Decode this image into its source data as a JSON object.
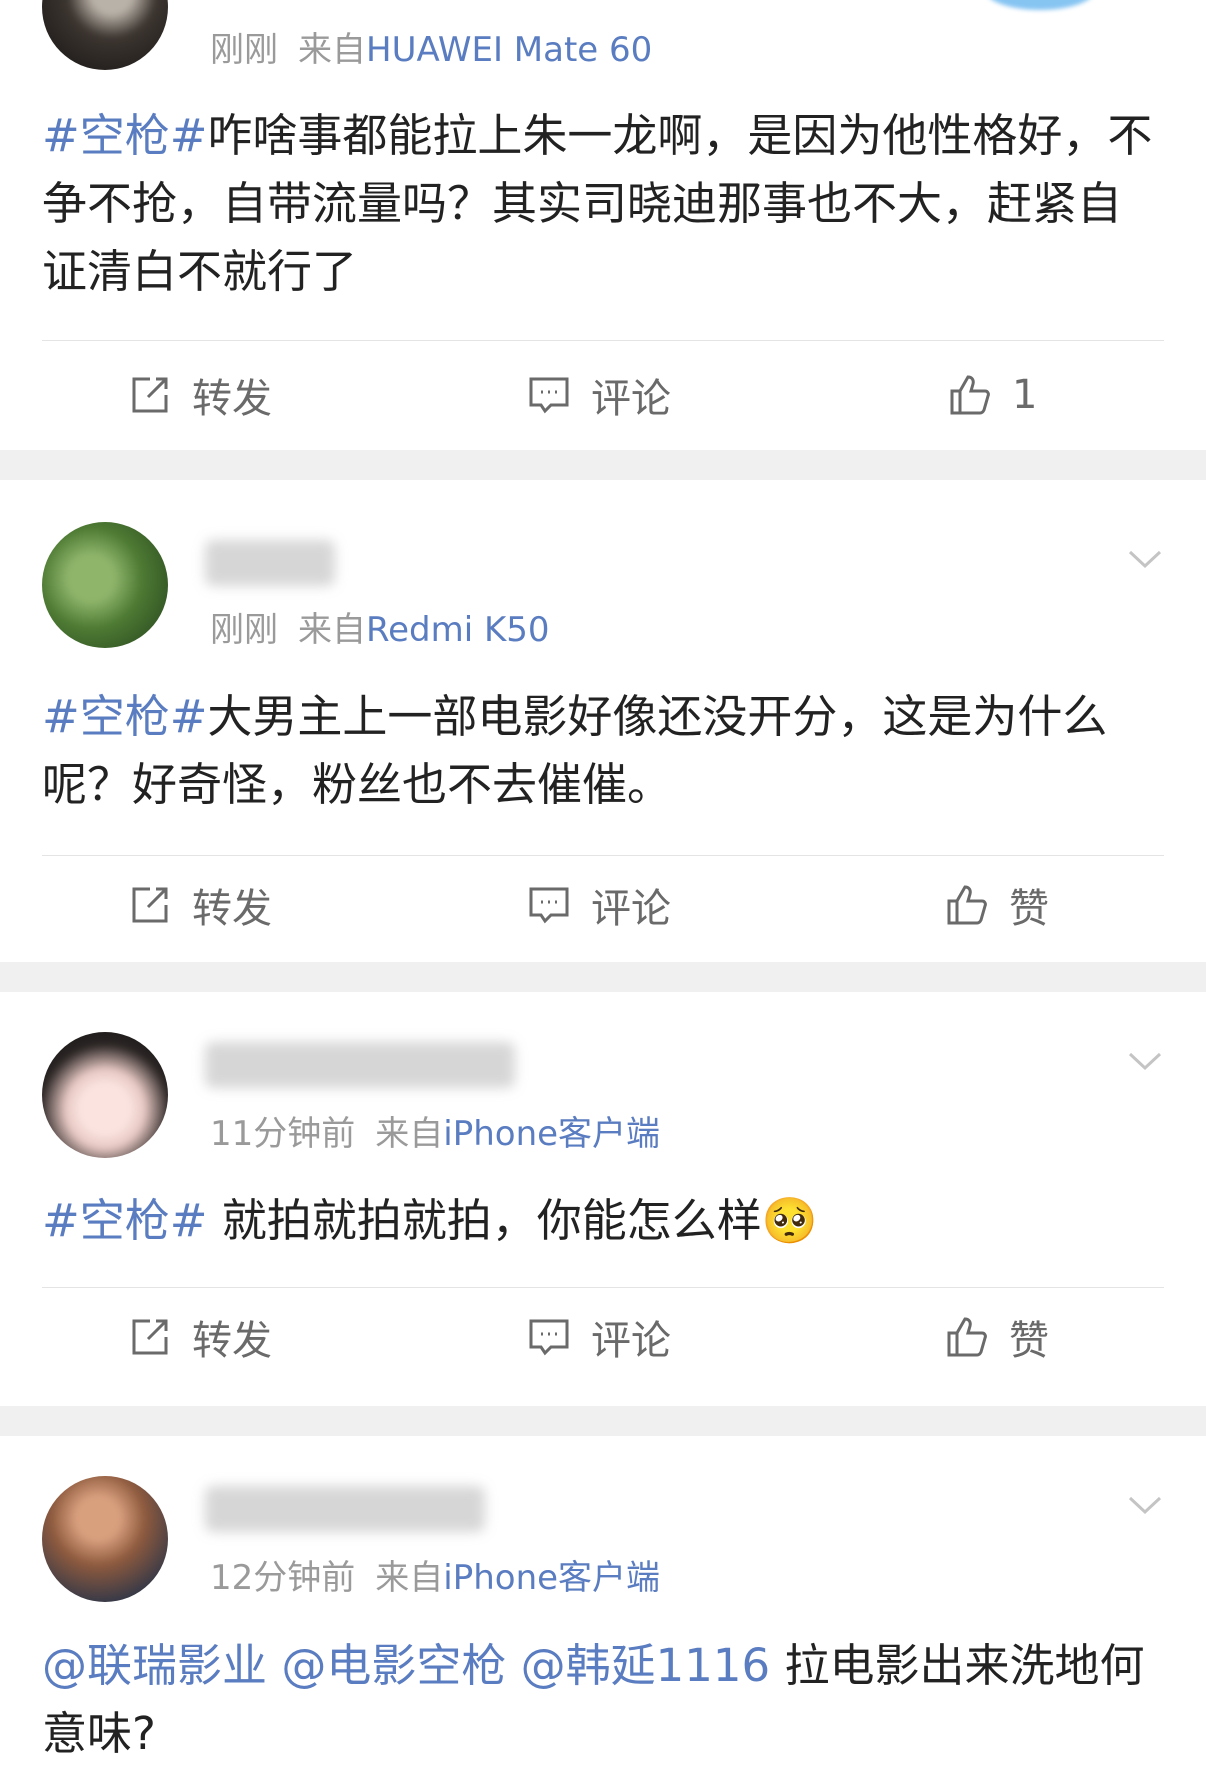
{
  "accent_color": "#5a7cc0",
  "posts": [
    {
      "time": "刚刚",
      "source_prefix": "来自",
      "device": "HUAWEI Mate 60",
      "tag": "#空枪#",
      "text": "咋啥事都能拉上朱一龙啊，是因为他性格好，不争不抢，自带流量吗？其实司晓迪那事也不大，赶紧自证清白不就行了",
      "repost_label": "转发",
      "comment_label": "评论",
      "like_label": "1"
    },
    {
      "time": "刚刚",
      "source_prefix": "来自",
      "device": "Redmi K50",
      "tag": "#空枪#",
      "text": "大男主上一部电影好像还没开分，这是为什么呢？好奇怪，粉丝也不去催催。",
      "repost_label": "转发",
      "comment_label": "评论",
      "like_label": "赞"
    },
    {
      "time": "11分钟前",
      "source_prefix": "来自",
      "device": "iPhone客户端",
      "tag": "#空枪#",
      "text": " 就拍就拍就拍，你能怎么样",
      "emoji": "🥺",
      "repost_label": "转发",
      "comment_label": "评论",
      "like_label": "赞"
    },
    {
      "time": "12分钟前",
      "source_prefix": "来自",
      "device": "iPhone客户端",
      "mentions": [
        "@联瑞影业",
        "@电影空枪",
        "@韩延1116"
      ],
      "text": " 拉电影出来洗地何意味?"
    }
  ]
}
